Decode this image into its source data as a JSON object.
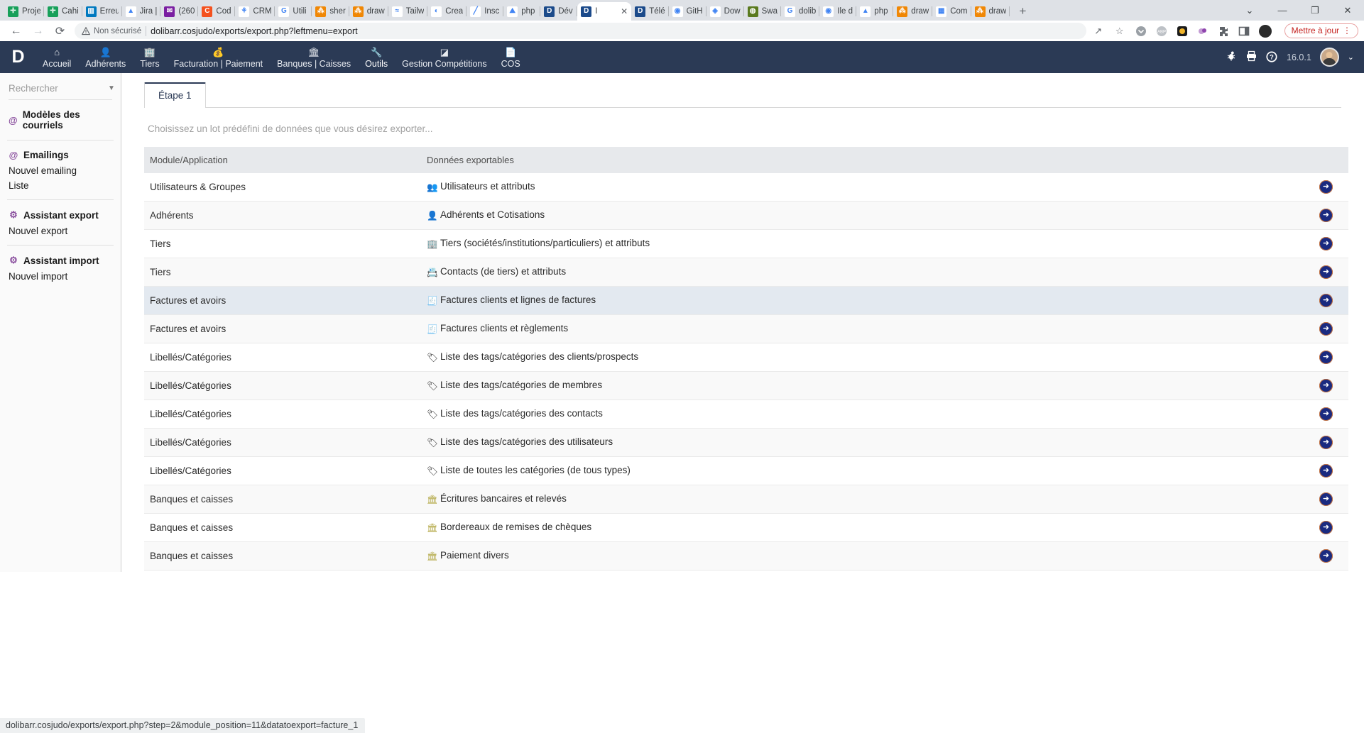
{
  "browser": {
    "tabs": [
      {
        "title": "Proje",
        "favicon": "drive-icon",
        "color": "#18a05a",
        "glyph": "✛",
        "active": false
      },
      {
        "title": "Cahi",
        "favicon": "drive-icon",
        "color": "#18a05a",
        "glyph": "✛",
        "active": false
      },
      {
        "title": "Erreu",
        "favicon": "trello-icon",
        "color": "#0079bf",
        "glyph": "▥",
        "active": false
      },
      {
        "title": "Jira |",
        "favicon": "jira-icon",
        "color": "#ffffff",
        "glyph": "▲",
        "active": false
      },
      {
        "title": "(260",
        "favicon": "mail-icon",
        "color": "#7a1ea1",
        "glyph": "✉",
        "active": false
      },
      {
        "title": "Cod",
        "favicon": "codepen-icon",
        "color": "#f4511e",
        "glyph": "C",
        "active": false
      },
      {
        "title": "CRM",
        "favicon": "crm-icon",
        "color": "#ffffff",
        "glyph": "⚘",
        "active": false
      },
      {
        "title": "Utili",
        "favicon": "google-icon",
        "color": "#ffffff",
        "glyph": "G",
        "active": false
      },
      {
        "title": "sher",
        "favicon": "drawio-icon",
        "color": "#f08705",
        "glyph": "⁂",
        "active": false
      },
      {
        "title": "draw",
        "favicon": "drawio-icon",
        "color": "#f08705",
        "glyph": "⁂",
        "active": false
      },
      {
        "title": "Tailw",
        "favicon": "tailwind-icon",
        "color": "#ffffff",
        "glyph": "≈",
        "active": false
      },
      {
        "title": "Crea",
        "favicon": "flame-icon",
        "color": "#ffffff",
        "glyph": "◐",
        "active": false
      },
      {
        "title": "Insc",
        "favicon": "pencil-icon",
        "color": "#ffffff",
        "glyph": "╱",
        "active": false
      },
      {
        "title": "php",
        "favicon": "phpmyadmin-icon",
        "color": "#ffffff",
        "glyph": "⛰",
        "active": false
      },
      {
        "title": "Dév",
        "favicon": "dolibarr-icon",
        "color": "#1b4a8a",
        "glyph": "D",
        "active": false
      },
      {
        "title": "I",
        "favicon": "dolibarr-icon",
        "color": "#1b4a8a",
        "glyph": "D",
        "active": true
      },
      {
        "title": "Télé",
        "favicon": "dolibarr-icon",
        "color": "#1b4a8a",
        "glyph": "D",
        "active": false
      },
      {
        "title": "GitH",
        "favicon": "github-icon",
        "color": "#ffffff",
        "glyph": "◉",
        "active": false
      },
      {
        "title": "Dow",
        "favicon": "diamond-icon",
        "color": "#ffffff",
        "glyph": "◈",
        "active": false
      },
      {
        "title": "Swa",
        "favicon": "swagger-icon",
        "color": "#5a7a1e",
        "glyph": "◍",
        "active": false
      },
      {
        "title": "dolib",
        "favicon": "google-icon",
        "color": "#ffffff",
        "glyph": "G",
        "active": false
      },
      {
        "title": "Ile d",
        "favicon": "maps-icon",
        "color": "#ffffff",
        "glyph": "◉",
        "active": false
      },
      {
        "title": "php",
        "favicon": "drive-icon",
        "color": "#ffffff",
        "glyph": "▲",
        "active": false
      },
      {
        "title": "draw",
        "favicon": "drawio-icon",
        "color": "#f08705",
        "glyph": "⁂",
        "active": false
      },
      {
        "title": "Com",
        "favicon": "chart-icon",
        "color": "#ffffff",
        "glyph": "▦",
        "active": false
      },
      {
        "title": "draw",
        "favicon": "drawio-icon",
        "color": "#f08705",
        "glyph": "⁂",
        "active": false
      }
    ],
    "new_tab_label": "+",
    "tab_close_label": "✕",
    "window_controls": {
      "tablist": "⌄",
      "minimize": "—",
      "maximize": "❐",
      "close": "✕"
    },
    "toolbar": {
      "back": "←",
      "forward": "→",
      "reload": "⟳",
      "security_label": "Non sécurisé",
      "security_icon": "warning-triangle-icon",
      "url": "dolibarr.cosjudo/exports/export.php?leftmenu=export",
      "share_icon": "↗",
      "bookmark_icon": "☆",
      "extensions": [
        "pocket-icon",
        "adblock-icon",
        "wallet-icon",
        "grammar-icon",
        "puzzle-icon",
        "sidepanel-icon"
      ],
      "update_label": "Mettre à jour",
      "menu_icon": "⋮"
    }
  },
  "app_nav": {
    "logo": "D",
    "items": [
      {
        "label": "Accueil",
        "icon": "home-icon",
        "glyph": "⌂",
        "active": false
      },
      {
        "label": "Adhérents",
        "icon": "user-icon",
        "glyph": "👤",
        "active": false
      },
      {
        "label": "Tiers",
        "icon": "building-icon",
        "glyph": "🏢",
        "active": false
      },
      {
        "label": "Facturation | Paiement",
        "icon": "invoice-icon",
        "glyph": "💰",
        "active": false
      },
      {
        "label": "Banques | Caisses",
        "icon": "bank-icon",
        "glyph": "🏛",
        "active": false
      },
      {
        "label": "Outils",
        "icon": "wrench-icon",
        "glyph": "🔧",
        "active": true
      },
      {
        "label": "Gestion Compétitions",
        "icon": "module-icon",
        "glyph": "◪",
        "active": false
      },
      {
        "label": "COS",
        "icon": "page-icon",
        "glyph": "📄",
        "active": false
      }
    ],
    "right": {
      "bug_icon": "🐞",
      "print_icon": "🖨",
      "help_icon": "?",
      "version": "16.0.1",
      "avatar": "user-avatar",
      "caret": "⌄"
    }
  },
  "sidebar": {
    "search": {
      "placeholder": "Rechercher",
      "value": "",
      "caret": "▼"
    },
    "groups": [
      {
        "title": "Modèles des courriels",
        "icon": "at-icon",
        "glyph": "@",
        "items": []
      },
      {
        "title": "Emailings",
        "icon": "at-icon",
        "glyph": "@",
        "items": [
          "Nouvel emailing",
          "Liste"
        ]
      },
      {
        "title": "Assistant export",
        "icon": "gears-icon",
        "glyph": "⚙",
        "items": [
          "Nouvel export"
        ]
      },
      {
        "title": "Assistant import",
        "icon": "gears-icon",
        "glyph": "⚙",
        "items": [
          "Nouvel import"
        ]
      }
    ]
  },
  "main": {
    "tab_label": "Étape 1",
    "hint": "Choisissez un lot prédéfini de données que vous désirez exporter...",
    "table": {
      "headers": [
        "Module/Application",
        "Données exportables",
        ""
      ],
      "action_glyph": "➜",
      "rows": [
        {
          "module": "Utilisateurs & Groupes",
          "data": "Utilisateurs et attributs",
          "icon": "users-icon",
          "glyph": "👥",
          "icon_color": "#4a4a4a",
          "highlight": false
        },
        {
          "module": "Adhérents",
          "data": "Adhérents et Cotisations",
          "icon": "member-icon",
          "glyph": "👤",
          "icon_color": "#8a6b3d",
          "highlight": false
        },
        {
          "module": "Tiers",
          "data": "Tiers (sociétés/institutions/particuliers) et attributs",
          "icon": "company-icon",
          "glyph": "🏢",
          "icon_color": "#5b5b9e",
          "highlight": false
        },
        {
          "module": "Tiers",
          "data": "Contacts (de tiers) et attributs",
          "icon": "contact-icon",
          "glyph": "📇",
          "icon_color": "#6b5bb5",
          "highlight": false
        },
        {
          "module": "Factures et avoirs",
          "data": "Factures clients et lignes de factures",
          "icon": "invoice-icon",
          "glyph": "🧾",
          "icon_color": "#5aa34a",
          "highlight": true
        },
        {
          "module": "Factures et avoirs",
          "data": "Factures clients et règlements",
          "icon": "invoice-icon",
          "glyph": "🧾",
          "icon_color": "#5aa34a",
          "highlight": false
        },
        {
          "module": "Libellés/Catégories",
          "data": "Liste des tags/catégories des clients/prospects",
          "icon": "tag-icon",
          "glyph": "🏷",
          "icon_color": "#222222",
          "highlight": false
        },
        {
          "module": "Libellés/Catégories",
          "data": "Liste des tags/catégories de membres",
          "icon": "tag-icon",
          "glyph": "🏷",
          "icon_color": "#222222",
          "highlight": false
        },
        {
          "module": "Libellés/Catégories",
          "data": "Liste des tags/catégories des contacts",
          "icon": "tag-icon",
          "glyph": "🏷",
          "icon_color": "#222222",
          "highlight": false
        },
        {
          "module": "Libellés/Catégories",
          "data": "Liste des tags/catégories des utilisateurs",
          "icon": "tag-icon",
          "glyph": "🏷",
          "icon_color": "#222222",
          "highlight": false
        },
        {
          "module": "Libellés/Catégories",
          "data": "Liste de toutes les catégories (de tous types)",
          "icon": "tag-icon",
          "glyph": "🏷",
          "icon_color": "#222222",
          "highlight": false
        },
        {
          "module": "Banques et caisses",
          "data": "Écritures bancaires et relevés",
          "icon": "bank-icon",
          "glyph": "🏛",
          "icon_color": "#b5aa4a",
          "highlight": false
        },
        {
          "module": "Banques et caisses",
          "data": "Bordereaux de remises de chèques",
          "icon": "bank-icon",
          "glyph": "🏛",
          "icon_color": "#b5aa4a",
          "highlight": false
        },
        {
          "module": "Banques et caisses",
          "data": "Paiement divers",
          "icon": "bank-icon",
          "glyph": "🏛",
          "icon_color": "#b5aa4a",
          "highlight": false
        }
      ]
    }
  },
  "status_bar": {
    "text": "dolibarr.cosjudo/exports/export.php?step=2&module_position=11&datatoexport=facture_1"
  },
  "colors": {
    "nav_bg": "#2b3a55",
    "accent": "#1a2a80",
    "highlight_row": "#e3e9f0",
    "header_row": "#e7e9ec"
  }
}
